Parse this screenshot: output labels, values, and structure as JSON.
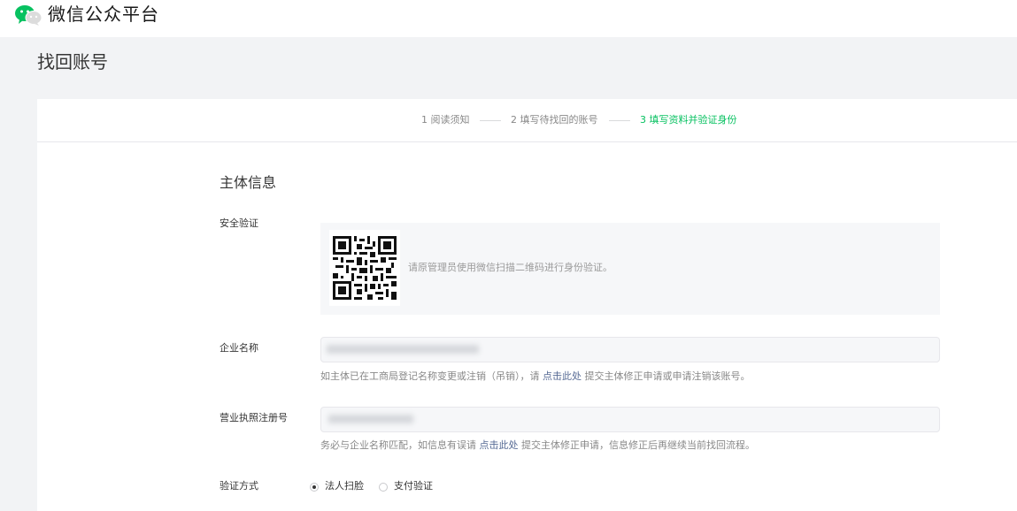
{
  "header": {
    "brand": "微信公众平台",
    "logo_icon": "wechat-logo-icon",
    "brand_color": "#07c160"
  },
  "page": {
    "title": "找回账号"
  },
  "steps": [
    {
      "label": "1 阅读须知",
      "active": false
    },
    {
      "label": "2 填写待找回的账号",
      "active": false
    },
    {
      "label": "3 填写资料并验证身份",
      "active": true
    }
  ],
  "form": {
    "section_title": "主体信息",
    "security": {
      "label": "安全验证",
      "qr_icon": "qr-code-icon",
      "tip": "请原管理员使用微信扫描二维码进行身份验证。"
    },
    "company": {
      "label": "企业名称",
      "hint_before": "如主体已在工商局登记名称变更或注销（吊销），请",
      "hint_link": "点击此处",
      "hint_after": "提交主体修正申请或申请注销该账号。"
    },
    "license": {
      "label": "营业执照注册号",
      "hint_before": "务必与企业名称匹配，如信息有误请",
      "hint_link": "点击此处",
      "hint_after": "提交主体修正申请，信息修正后再继续当前找回流程。"
    },
    "method": {
      "label": "验证方式",
      "options": [
        {
          "label": "法人扫脸",
          "checked": true
        },
        {
          "label": "支付验证",
          "checked": false
        }
      ]
    }
  },
  "colors": {
    "accent": "#07c160",
    "link": "#576b95",
    "background": "#f2f3f5"
  }
}
